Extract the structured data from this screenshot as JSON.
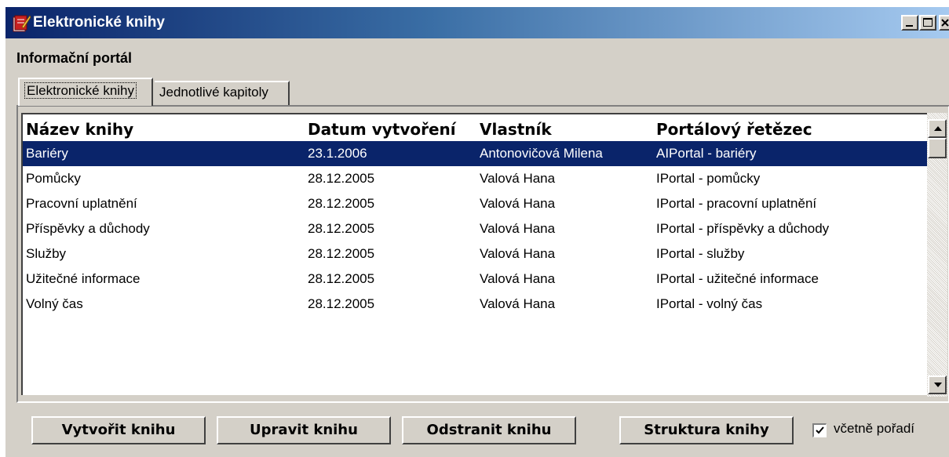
{
  "window": {
    "title": "Elektronické knihy",
    "title_gradient": [
      "#0a246a",
      "#a6caf0"
    ]
  },
  "header": {
    "portal_label": "Informační portál"
  },
  "tabs": [
    {
      "label": "Elektronické knihy",
      "active": true
    },
    {
      "label": "Jednotlivé kapitoly",
      "active": false
    }
  ],
  "table": {
    "columns": [
      "Název knihy",
      "Datum vytvoření",
      "Vlastník",
      "Portálový řetězec"
    ],
    "selected_row": 0,
    "selection_color": "#0a246a",
    "rows": [
      {
        "name": "Bariéry",
        "date": "23.1.2006",
        "owner": "Antonovičová Milena",
        "chain": "AIPortal - bariéry"
      },
      {
        "name": "Pomůcky",
        "date": "28.12.2005",
        "owner": "Valová Hana",
        "chain": "IPortal - pomůcky"
      },
      {
        "name": "Pracovní uplatnění",
        "date": "28.12.2005",
        "owner": "Valová Hana",
        "chain": "IPortal - pracovní uplatnění"
      },
      {
        "name": "Příspěvky a důchody",
        "date": "28.12.2005",
        "owner": "Valová Hana",
        "chain": "IPortal - příspěvky a důchody"
      },
      {
        "name": "Služby",
        "date": "28.12.2005",
        "owner": "Valová Hana",
        "chain": "IPortal - služby"
      },
      {
        "name": "Užitečné informace",
        "date": "28.12.2005",
        "owner": "Valová Hana",
        "chain": "IPortal - užitečné informace"
      },
      {
        "name": "Volný čas",
        "date": "28.12.2005",
        "owner": "Valová Hana",
        "chain": "IPortal - volný čas"
      }
    ]
  },
  "buttons": {
    "create": "Vytvořit knihu",
    "edit": "Upravit knihu",
    "delete": "Odstranit knihu",
    "structure": "Struktura knihy"
  },
  "include_order": {
    "label": "včetně pořadí",
    "checked": true
  },
  "icons": {
    "app": "book-icon",
    "minimize": "minimize-icon",
    "maximize": "maximize-icon",
    "close": "close-icon",
    "scroll_up": "arrow-up-icon",
    "scroll_down": "arrow-down-icon",
    "check": "checkmark-icon"
  }
}
